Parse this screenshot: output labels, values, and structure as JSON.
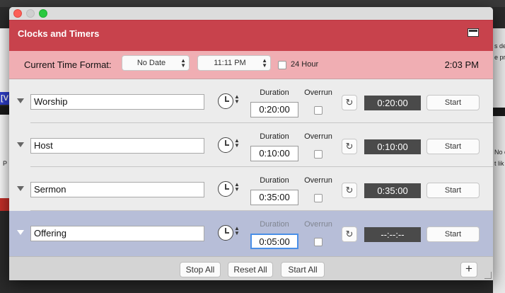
{
  "background": {
    "right_text": [
      "s de",
      "e pr",
      "No c",
      "t lik"
    ],
    "left_text": [
      "[V",
      "P"
    ]
  },
  "window": {
    "title": "Clocks and Timers",
    "header_color": "#c8424c",
    "format_bar_color": "#f0aeb3",
    "selected_row_color": "#b7bed8"
  },
  "format_bar": {
    "label": "Current Time Format:",
    "date_format": "No Date",
    "time_format": "11:11 PM",
    "hour24_label": "24 Hour",
    "hour24_checked": false,
    "current_time": "2:03 PM"
  },
  "timer_columns": {
    "duration_label": "Duration",
    "overrun_label": "Overrun"
  },
  "timers": [
    {
      "name": "Worship",
      "duration": "0:20:00",
      "overrun": false,
      "display": "0:20:00",
      "start_label": "Start",
      "selected": false
    },
    {
      "name": "Host",
      "duration": "0:10:00",
      "overrun": false,
      "display": "0:10:00",
      "start_label": "Start",
      "selected": false
    },
    {
      "name": "Sermon",
      "duration": "0:35:00",
      "overrun": false,
      "display": "0:35:00",
      "start_label": "Start",
      "selected": false
    },
    {
      "name": "Offering",
      "duration": "0:05:00",
      "overrun": false,
      "display": "--:--:--",
      "start_label": "Start",
      "selected": true
    }
  ],
  "icons": {
    "disclosure": "triangle-down-icon",
    "clock": "clock-icon",
    "reset": "refresh-icon",
    "screen": "screen-icon",
    "add": "plus-icon",
    "reset_glyph": "↻",
    "up_down_glyph": "▲▼"
  },
  "bottom_bar": {
    "stop_all": "Stop All",
    "reset_all": "Reset All",
    "start_all": "Start All",
    "add": "+"
  }
}
